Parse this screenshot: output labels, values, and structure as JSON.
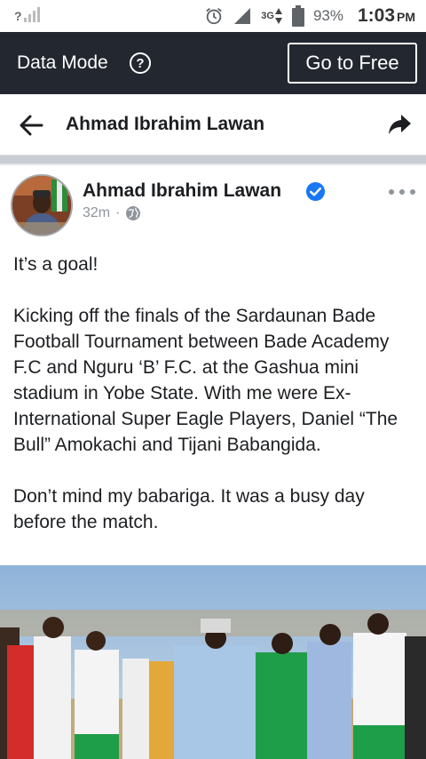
{
  "status_bar": {
    "signal_left": "?",
    "network": "3G",
    "battery_pct": "93%",
    "time": "1:03",
    "ampm": "PM"
  },
  "data_bar": {
    "label": "Data Mode",
    "info": "?",
    "button_label": "Go to Free"
  },
  "header": {
    "title": "Ahmad Ibrahim Lawan"
  },
  "post": {
    "author": "Ahmad Ibrahim Lawan",
    "time": "32m",
    "separator": "·",
    "paragraphs": [
      "It’s a goal!",
      "Kicking off the finals of the Sardaunan Bade Football Tournament between Bade Academy F.C and Nguru ‘B’ F.C. at the Gashua mini stadium in Yobe State. With me were Ex-International Super Eagle Players, Daniel “The Bull” Amokachi and Tijani Babangida.",
      "Don’t mind my babariga. It was a busy day before the match."
    ]
  },
  "colors": {
    "data_bar_bg": "#23272f",
    "verified": "#1877f2",
    "meta_gray": "#90949c"
  }
}
